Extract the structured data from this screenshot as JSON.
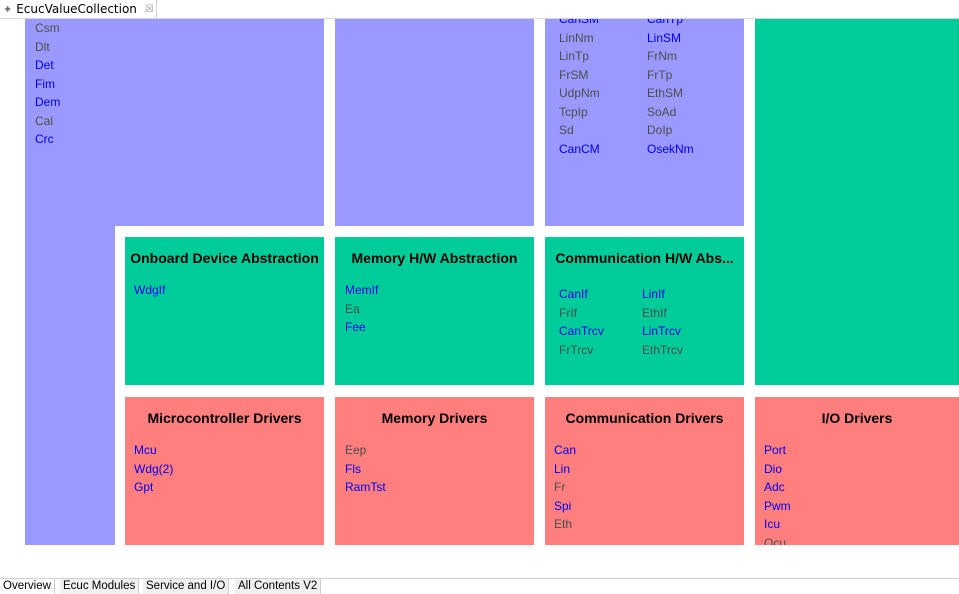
{
  "editor_tab": {
    "title": "EcucValueCollection",
    "icon": "ecuc-collection-icon",
    "close_glyph": "☒"
  },
  "colors": {
    "service": "#9999ff",
    "abstraction": "#00cc99",
    "driver": "#ff7f7f",
    "enabled_text": "#0000ee",
    "disabled_text": "#4d4d4d"
  },
  "blocks": {
    "system_services": {
      "items": [
        {
          "label": "Csm",
          "enabled": false
        },
        {
          "label": "Dlt",
          "enabled": false
        },
        {
          "label": "Det",
          "enabled": true
        },
        {
          "label": "Fim",
          "enabled": true
        },
        {
          "label": "Dem",
          "enabled": true
        },
        {
          "label": "Cal",
          "enabled": false
        },
        {
          "label": "Crc",
          "enabled": true
        }
      ]
    },
    "comm_services": {
      "left": [
        {
          "label": "CanSM",
          "enabled": true
        },
        {
          "label": "LinNm",
          "enabled": false
        },
        {
          "label": "LinTp",
          "enabled": false
        },
        {
          "label": "FrSM",
          "enabled": false
        },
        {
          "label": "UdpNm",
          "enabled": false
        },
        {
          "label": "TcpIp",
          "enabled": false
        },
        {
          "label": "Sd",
          "enabled": false
        },
        {
          "label": "CanCM",
          "enabled": true
        }
      ],
      "right": [
        {
          "label": "CanTp",
          "enabled": true
        },
        {
          "label": "LinSM",
          "enabled": true
        },
        {
          "label": "FrNm",
          "enabled": false
        },
        {
          "label": "FrTp",
          "enabled": false
        },
        {
          "label": "EthSM",
          "enabled": false
        },
        {
          "label": "SoAd",
          "enabled": false
        },
        {
          "label": "DoIp",
          "enabled": false
        },
        {
          "label": "OsekNm",
          "enabled": true
        }
      ]
    },
    "onboard_abs": {
      "title": "Onboard Device Abstraction",
      "items": [
        {
          "label": "WdgIf",
          "enabled": true
        }
      ]
    },
    "memory_abs": {
      "title": "Memory H/W Abstraction",
      "items": [
        {
          "label": "MemIf",
          "enabled": true
        },
        {
          "label": "Ea",
          "enabled": false
        },
        {
          "label": "Fee",
          "enabled": true
        }
      ]
    },
    "comm_abs": {
      "title": "Communication H/W Abs...",
      "left": [
        {
          "label": "CanIf",
          "enabled": true
        },
        {
          "label": "FrIf",
          "enabled": false
        },
        {
          "label": "CanTrcv",
          "enabled": true
        },
        {
          "label": "FrTrcv",
          "enabled": false
        }
      ],
      "right": [
        {
          "label": "LinIf",
          "enabled": true
        },
        {
          "label": "EthIf",
          "enabled": false
        },
        {
          "label": "LinTrcv",
          "enabled": true
        },
        {
          "label": "EthTrcv",
          "enabled": false
        }
      ]
    },
    "mcu_drivers": {
      "title": "Microcontroller Drivers",
      "items": [
        {
          "label": "Mcu",
          "enabled": true
        },
        {
          "label": "Wdg(2)",
          "enabled": true
        },
        {
          "label": "Gpt",
          "enabled": true
        }
      ]
    },
    "memory_drivers": {
      "title": "Memory Drivers",
      "items": [
        {
          "label": "Eep",
          "enabled": false
        },
        {
          "label": "Fls",
          "enabled": true
        },
        {
          "label": "RamTst",
          "enabled": true
        }
      ]
    },
    "comm_drivers": {
      "title": "Communication Drivers",
      "items": [
        {
          "label": "Can",
          "enabled": true
        },
        {
          "label": "Lin",
          "enabled": true
        },
        {
          "label": "Fr",
          "enabled": false
        },
        {
          "label": "Spi",
          "enabled": true
        },
        {
          "label": "Eth",
          "enabled": false
        }
      ]
    },
    "io_drivers": {
      "title": "I/O Drivers",
      "items": [
        {
          "label": "Port",
          "enabled": true
        },
        {
          "label": "Dio",
          "enabled": true
        },
        {
          "label": "Adc",
          "enabled": true
        },
        {
          "label": "Pwm",
          "enabled": true
        },
        {
          "label": "Icu",
          "enabled": true
        },
        {
          "label": "Ocu",
          "enabled": false
        }
      ]
    }
  },
  "bottom_tabs": [
    {
      "label": "Overview",
      "active": true
    },
    {
      "label": "Ecuc Modules",
      "active": false
    },
    {
      "label": "Service and I/O",
      "active": false
    },
    {
      "label": "All Contents V2",
      "active": false
    }
  ]
}
